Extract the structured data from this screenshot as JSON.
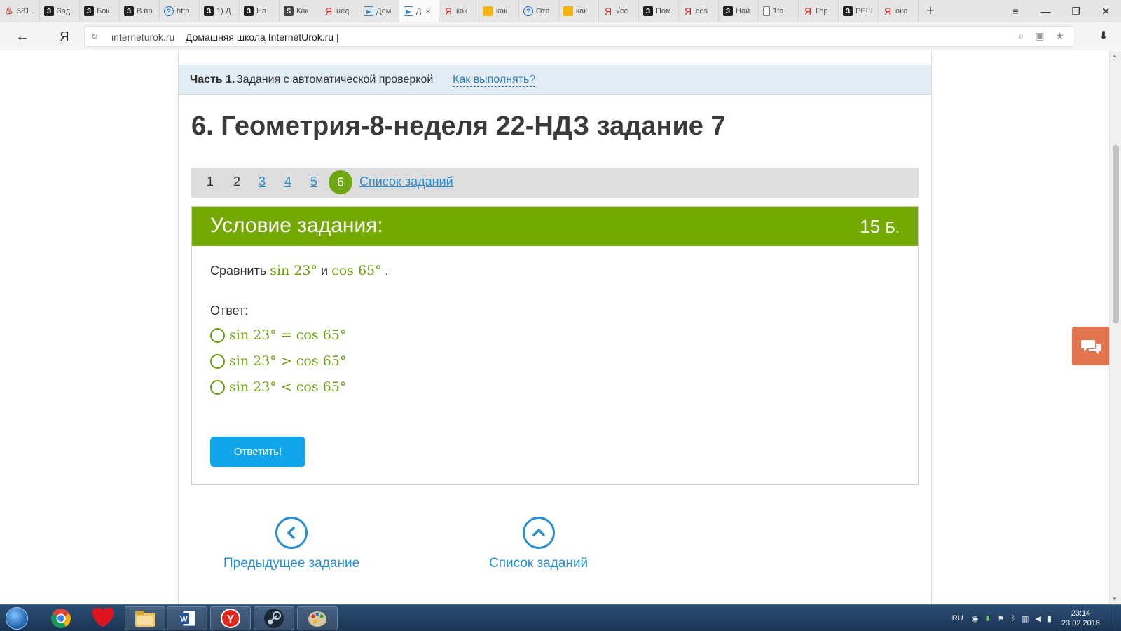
{
  "browser": {
    "tabs": [
      {
        "icon": "fire-icon",
        "label": "581"
      },
      {
        "icon": "z-icon",
        "label": "Зад"
      },
      {
        "icon": "z-icon",
        "label": "Бок"
      },
      {
        "icon": "z-icon",
        "label": "В пр"
      },
      {
        "icon": "question-icon",
        "label": "http"
      },
      {
        "icon": "z-icon",
        "label": "1) Д"
      },
      {
        "icon": "z-icon",
        "label": "На"
      },
      {
        "icon": "s-icon",
        "label": "Как"
      },
      {
        "icon": "yandex-icon",
        "label": "нед"
      },
      {
        "icon": "play-icon",
        "label": "Дом"
      },
      {
        "icon": "play-icon",
        "label": "Д"
      },
      {
        "icon": "yandex-icon",
        "label": "как"
      },
      {
        "icon": "image-icon",
        "label": "как"
      },
      {
        "icon": "question-icon",
        "label": "Отв"
      },
      {
        "icon": "image-icon",
        "label": "как"
      },
      {
        "icon": "yandex-icon",
        "label": "√cc"
      },
      {
        "icon": "z-icon",
        "label": "Пом"
      },
      {
        "icon": "yandex-icon",
        "label": "cos"
      },
      {
        "icon": "z-icon",
        "label": "Най"
      },
      {
        "icon": "doc-icon",
        "label": "1fa"
      },
      {
        "icon": "yandex-icon",
        "label": "Гор"
      },
      {
        "icon": "z-icon",
        "label": "РЕШ"
      },
      {
        "icon": "yandex-icon",
        "label": "окс"
      }
    ],
    "tab_close": "×",
    "new_tab": "+",
    "window_controls": {
      "menu": "≡",
      "minimize": "—",
      "restore": "❐",
      "close": "✕"
    },
    "back": "←",
    "yandex_button": "Я",
    "url_domain": "interneturok.ru",
    "url_title": "Домашняя школа InternetUrok.ru |",
    "download": "⬇"
  },
  "part_bar": {
    "bold": "Часть 1.",
    "text": "Задания с автоматической проверкой",
    "link": "Как выполнять?"
  },
  "task_title": "6. Геометрия-8-неделя 22-НДЗ задание 7",
  "task_nav": {
    "items": [
      "1",
      "2",
      "3",
      "4",
      "5"
    ],
    "current": "6",
    "list_link": "Список заданий"
  },
  "task": {
    "header_title": "Условие задания:",
    "points": "15",
    "points_unit": "Б.",
    "question_prefix": "Сравнить",
    "question_expr1": "sin 23°",
    "question_mid": "и",
    "question_expr2": "cos 65°",
    "question_end": ".",
    "answer_label": "Ответ:",
    "options": [
      "sin 23° = cos 65°",
      "sin 23° > cos 65°",
      "sin 23° < cos 65°"
    ],
    "submit": "Ответить!"
  },
  "bottom_nav": {
    "prev_label": "Предыдущее задание",
    "list_label": "Список заданий"
  },
  "taskbar": {
    "lang": "RU",
    "time": "23:14",
    "date": "23.02.2018"
  },
  "colors": {
    "green": "#74aa00",
    "link_blue": "#2a8fd1",
    "button_blue": "#10a5e8",
    "chat_orange": "#e2744f"
  }
}
